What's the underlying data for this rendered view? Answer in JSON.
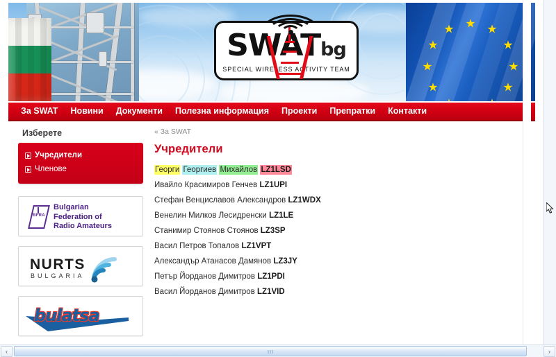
{
  "banner": {
    "logo_text": "SWAT",
    "logo_suffix": "bg",
    "tagline": "SPECIAL WIRELESS ACTIVITY TEAM",
    "left_image_name": "bulgarian-flag-radio-tower",
    "right_image_name": "european-union-flag"
  },
  "nav": {
    "items": [
      {
        "label": "За SWAT",
        "name": "nav-item-about-swat"
      },
      {
        "label": "Новини",
        "name": "nav-item-news"
      },
      {
        "label": "Документи",
        "name": "nav-item-documents"
      },
      {
        "label": "Полезна информация",
        "name": "nav-item-useful-info"
      },
      {
        "label": "Проекти",
        "name": "nav-item-projects"
      },
      {
        "label": "Препратки",
        "name": "nav-item-links"
      },
      {
        "label": "Контакти",
        "name": "nav-item-contacts"
      }
    ]
  },
  "sidebar": {
    "title": "Изберете",
    "links": [
      {
        "label": "Учредители",
        "active": true
      },
      {
        "label": "Членове",
        "active": false
      }
    ],
    "banners": [
      {
        "name": "bfra",
        "badge": "BFRA",
        "line1": "Bulgarian",
        "line2": "Federation of",
        "line3": "Radio Amateurs",
        "color": "#4b2185"
      },
      {
        "name": "nurts",
        "word": "NURTS",
        "sub": "BULGARIA",
        "color": "#2f9fd8"
      },
      {
        "name": "bulatsa",
        "word": "bulatsa",
        "color": "#1a5fa0"
      }
    ]
  },
  "main": {
    "breadcrumb": "« За SWAT",
    "title": "Учредители",
    "people": [
      {
        "highlighted": true,
        "parts": [
          {
            "text": "Георги",
            "hl": "#FFFF66"
          },
          {
            "text": "Георгиев",
            "hl": "#AFEEEE"
          },
          {
            "text": "Михайлов",
            "hl": "#93EE93"
          },
          {
            "text": "LZ1LSD",
            "hl": "#FF8899",
            "bold": true
          }
        ]
      },
      {
        "highlighted": false,
        "name": "Ивайло Красимиров Генчев",
        "call": "LZ1UPI"
      },
      {
        "highlighted": false,
        "name": "Стефан Венциславов Александров",
        "call": "LZ1WDX"
      },
      {
        "highlighted": false,
        "name": "Венелин Милков Лесидренски",
        "call": "LZ1LE"
      },
      {
        "highlighted": false,
        "name": "Станимир Стоянов Стоянов",
        "call": "LZ3SP"
      },
      {
        "highlighted": false,
        "name": "Васил Петров Топалов",
        "call": "LZ1VPT"
      },
      {
        "highlighted": false,
        "name": "Александър Атанасов Дамянов",
        "call": "LZ3JY"
      },
      {
        "highlighted": false,
        "name": "Петър Йорданов Димитров",
        "call": "LZ1PDI"
      },
      {
        "highlighted": false,
        "name": "Васил Йорданов Димитров",
        "call": "LZ1VID"
      }
    ]
  },
  "scrollbars": {
    "left_arrow": "‹",
    "right_arrow": "›"
  },
  "colors": {
    "brand_red": "#cf0012",
    "title_red": "#cf0a1e",
    "sidebar_box": "#c30017"
  }
}
